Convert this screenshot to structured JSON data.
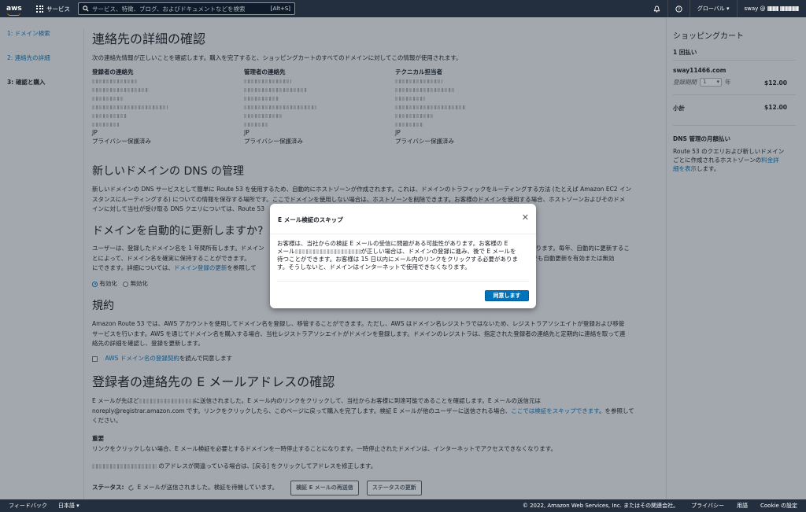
{
  "nav": {
    "logo": "aws",
    "services": "サービス",
    "search_placeholder": "サービス、特徴、ブログ、およびドキュメントなどを検索",
    "shortcut": "[Alt+S]",
    "region": "グローバル ▾",
    "account": "sway @",
    "icons": [
      "bell-icon",
      "help-icon",
      "grid-icon",
      "search-icon"
    ]
  },
  "sidebar": {
    "steps": [
      {
        "label": "1: ドメイン検索"
      },
      {
        "label": "2: 連絡先の詳細"
      },
      {
        "label": "3: 確認と購入"
      }
    ]
  },
  "main": {
    "title": "連絡先の詳細の確認",
    "intro": "次の連絡先情報が正しいことを確認します。購入を完了すると、ショッピングカートのすべてのドメインに対してこの情報が使用されます。",
    "contacts": [
      {
        "heading": "登録者の連絡先",
        "country": "JP",
        "privacy": "プライバシー保護済み"
      },
      {
        "heading": "管理者の連絡先",
        "country": "JP",
        "privacy": "プライバシー保護済み"
      },
      {
        "heading": "テクニカル担当者",
        "country": "JP",
        "privacy": "プライバシー保護済み"
      }
    ],
    "dns": {
      "title": "新しいドメインの DNS の管理",
      "line1": "新しいドメインの DNS サービスとして簡単に Route 53 を使用するため、自動的にホストゾーンが作成されます。これは、ドメインのトラフィックをルーティングする方法 (たとえば Amazon EC2 イン",
      "line2": "スタンスにルーティングする) についての情報を保存する場所です。ここでドメインを使用しない場合は、ホストゾーンを削除できます。お客様のドメインを使用する場合、ホストゾーンおよびそのドメ",
      "line3": "インに対して当社が受け取る DNS クエリについては、Route 53"
    },
    "renew": {
      "title": "ドメインを自動的に更新しますか?",
      "line1a": "ユーザーは、登録したドメイン名を 1 年間所有します。ドメイン",
      "line1b": "になります。毎年、自動的に更新するこ",
      "line2a": "とによって、ドメイン名を確実に保持することができます。",
      "line2b": "て、いつでも自動更新を有効または無効",
      "line3a": "にできます。詳細については、",
      "line3link": "ドメイン登録の更新",
      "line3b": "を参照して",
      "opt_on": "有効化",
      "opt_off": "無効化"
    },
    "terms": {
      "title": "規約",
      "line1": "Amazon Route 53 では、AWS アカウントを使用してドメイン名を登録し、移管することができます。ただし、AWS はドメイン名レジストラではないため、レジストラアソシエイトが登録および移管",
      "line2": "サービスを行います。AWS を通じてドメイン名を購入する場合、当社レジストラアソシエイトがドメインを登録します。ドメインのレジストラは、指定された登録者の連絡先と定期的に連絡を取って連",
      "line3": "絡先の詳細を確認し、登録を更新します。",
      "agree_link": "AWS ドメイン名の登録契約",
      "agree_text": "を読んで同意します"
    },
    "verify": {
      "title": "登録者の連絡先の E メールアドレスの確認",
      "line1a": "E メールが先ほど",
      "line1b": "に送信されました。E メール内のリンクをクリックして、当社からお客様に到達可能であることを確認します。E メールの送信元は",
      "line2": "noreply@registrar.amazon.com です。リンクをクリックしたら、このページに戻って購入を完了します。検証 E メールが他のユーザーに送信される場合、",
      "line2link": "ここでは検証をスキップできます",
      "line2b": "。を参照して",
      "line3": "ください。",
      "important_label": "重要",
      "important_text": "リンクをクリックしない場合、E メール検証を必要とするドメインを一時停止することになります。一時停止されたドメインは、インターネットでアクセスできなくなります。",
      "wrong_text": "のアドレスが間違っている場合は、[戻る] をクリックしてアドレスを修正します。",
      "status_label": "ステータス:",
      "status_text": "E メールが送信されました。検証を待機しています。",
      "resend_btn": "検証 E メールの再送信",
      "refresh_btn": "ステータスの更新"
    }
  },
  "cart": {
    "title": "ショッピングカート",
    "one_time": "1 回払い",
    "domain": "sway11466.com",
    "period_label": "登録期間",
    "period_value": "1",
    "period_unit": "年",
    "price": "$12.00",
    "subtotal_label": "小計",
    "subtotal": "$12.00",
    "dns_monthly_title": "DNS 管理の月額払い",
    "dns_text1": "Route 53 のクエリおよび新しいドメイン",
    "dns_text2": "ごとに作成されるホストゾーンの",
    "dns_link1": "料金詳",
    "dns_link2": "細を表示",
    "dns_text3": "します。"
  },
  "modal": {
    "title": "E メール検証のスキップ",
    "line1": "お客様は、当社からの検証 E メールの受信に問題がある可能性があります。お客様の E",
    "line2a": "メール",
    "line2b": "が正しい場合は、ドメインの登録に進み、後で E メールを",
    "line3": "待つことができます。お客様は 15 日以内にメール内のリンクをクリックする必要がありま",
    "line4": "す。そうしないと、ドメインはインターネットで使用できなくなります。",
    "ok": "同意します",
    "close": "✕"
  },
  "footer": {
    "feedback": "フィードバック",
    "language": "日本語 ▾",
    "copyright": "© 2022, Amazon Web Services, Inc. またはその関連会社。",
    "privacy": "プライバシー",
    "terms": "用語",
    "cookie": "Cookie の設定"
  }
}
